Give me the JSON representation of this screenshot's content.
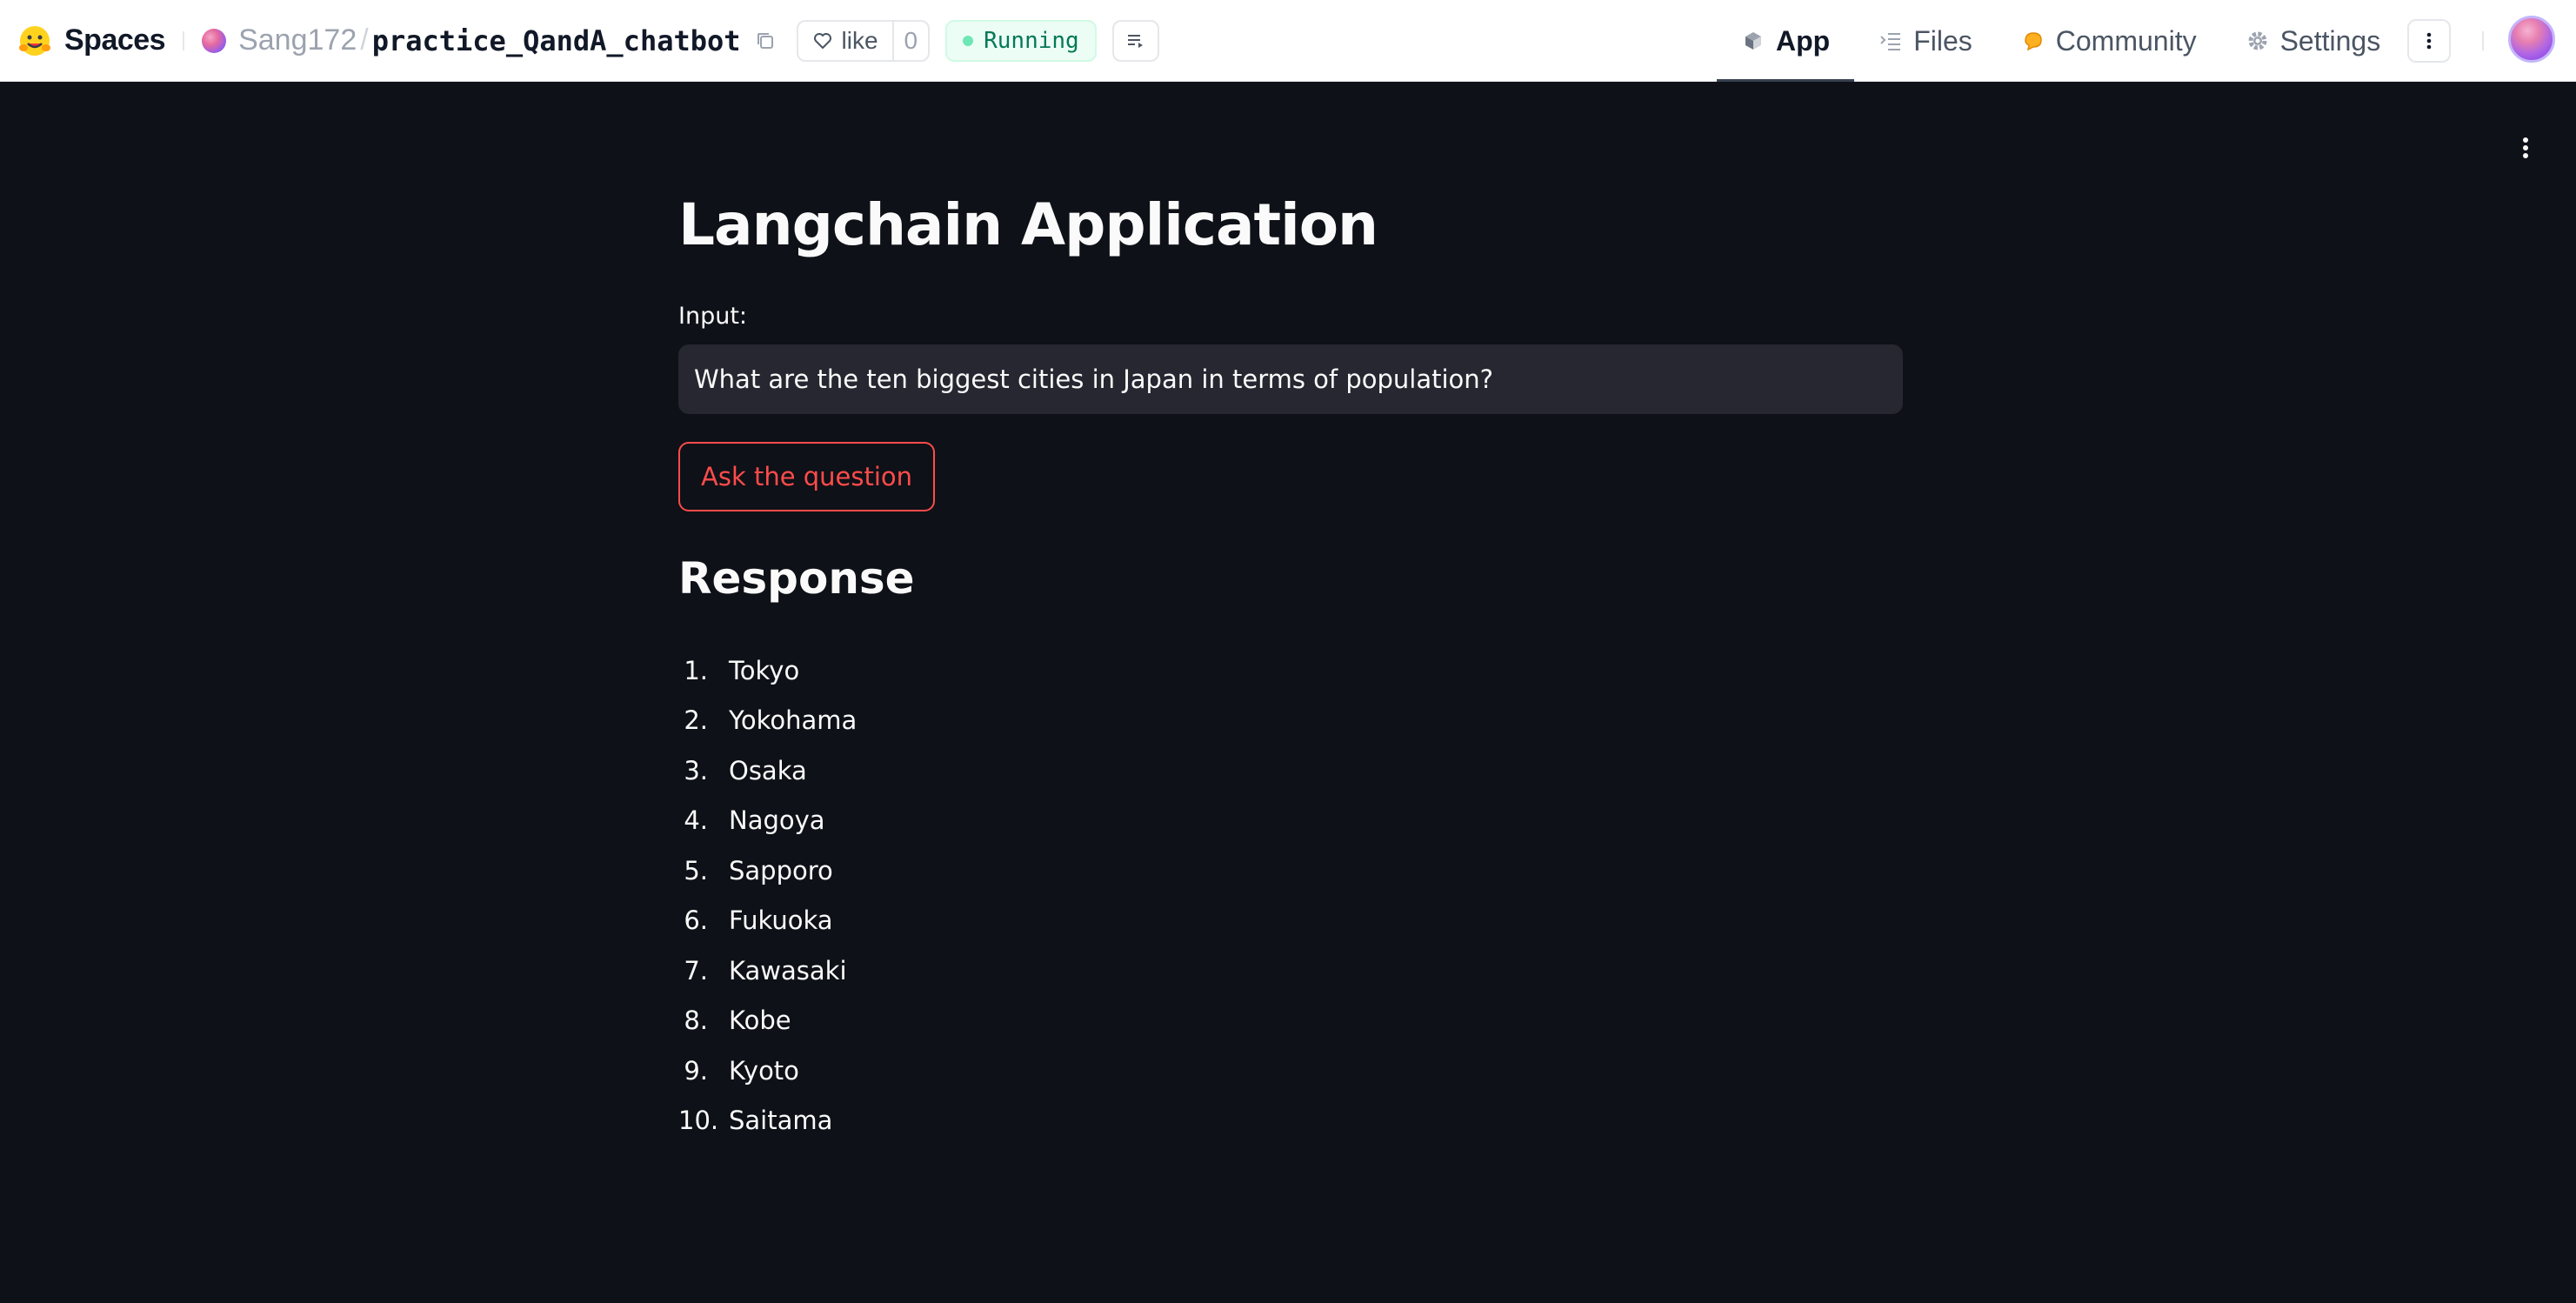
{
  "header": {
    "brand": "Spaces",
    "owner": "Sang172",
    "separator": "/",
    "repo": "practice_QandA_chatbot",
    "like_label": "like",
    "like_count": "0",
    "status": "Running",
    "status_color": "#047857",
    "nav": [
      {
        "label": "App",
        "icon": "cube-icon",
        "active": true
      },
      {
        "label": "Files",
        "icon": "files-icon",
        "active": false
      },
      {
        "label": "Community",
        "icon": "community-icon",
        "active": false
      },
      {
        "label": "Settings",
        "icon": "gear-icon",
        "active": false
      }
    ]
  },
  "app": {
    "title": "Langchain Application",
    "input_label": "Input:",
    "input_value": "What are the ten biggest cities in Japan in terms of population?",
    "button_label": "Ask the question",
    "accent_color": "#ff4b4b",
    "response_heading": "Response",
    "response_items": [
      {
        "num": "1.",
        "text": "Tokyo"
      },
      {
        "num": "2.",
        "text": "Yokohama"
      },
      {
        "num": "3.",
        "text": "Osaka"
      },
      {
        "num": "4.",
        "text": "Nagoya"
      },
      {
        "num": "5.",
        "text": "Sapporo"
      },
      {
        "num": "6.",
        "text": "Fukuoka"
      },
      {
        "num": "7.",
        "text": "Kawasaki"
      },
      {
        "num": "8.",
        "text": "Kobe"
      },
      {
        "num": "9.",
        "text": "Kyoto"
      },
      {
        "num": "10.",
        "text": "Saitama"
      }
    ]
  }
}
